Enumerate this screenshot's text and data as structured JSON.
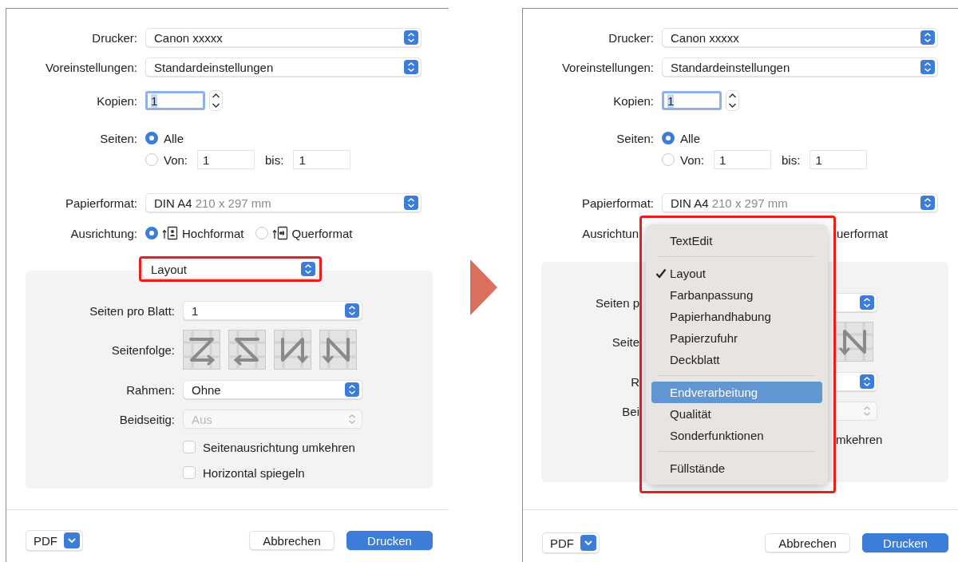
{
  "dialogs": [
    {
      "kind": "full",
      "printer": {
        "label": "Drucker:",
        "value": "Canon xxxxx"
      },
      "presets": {
        "label": "Voreinstellungen:",
        "value": "Standardeinstellungen"
      },
      "copies": {
        "label": "Kopien:",
        "value": "1"
      },
      "pages": {
        "label": "Seiten:",
        "all": {
          "label": "Alle",
          "selected": true
        },
        "range": {
          "label": "Von:",
          "selected": false,
          "from": "1",
          "to_label": "bis:",
          "to": "1"
        }
      },
      "paper": {
        "label": "Papierformat:",
        "value": "DIN A4",
        "size": "210 x 297 mm"
      },
      "orientation": {
        "label": "Ausrichtung:",
        "options": [
          {
            "kind": "portrait",
            "label": "Hochformat",
            "selected": true
          },
          {
            "kind": "landscape",
            "label": "Querformat",
            "selected": false
          }
        ]
      },
      "section": {
        "value": "Layout",
        "highlighted": true
      },
      "layout": {
        "pages_per_sheet": {
          "label": "Seiten pro Blatt:",
          "value": "1"
        },
        "order": {
          "label": "Seitenfolge:",
          "options": [
            {
              "kind": "z"
            },
            {
              "kind": "z-reverse"
            },
            {
              "kind": "n-reverse"
            },
            {
              "kind": "n"
            }
          ]
        },
        "border": {
          "label": "Rahmen:",
          "value": "Ohne"
        },
        "two_sided": {
          "label": "Beidseitig:",
          "value": "Aus",
          "disabled": true
        },
        "checkboxes": [
          {
            "label": "Seitenausrichtung umkehren",
            "checked": false
          },
          {
            "label": "Horizontal spiegeln",
            "checked": false
          }
        ]
      },
      "footer": {
        "pdf": "PDF",
        "cancel": "Abbrechen",
        "print": "Drucken"
      }
    },
    {
      "kind": "covered",
      "printer": {
        "label": "Drucker:",
        "value": "Canon xxxxx"
      },
      "presets": {
        "label": "Voreinstellungen:",
        "value": "Standardeinstellungen"
      },
      "copies": {
        "label": "Kopien:",
        "value": "1"
      },
      "pages": {
        "label": "Seiten:",
        "all": {
          "label": "Alle",
          "selected": true
        },
        "range": {
          "label": "Von:",
          "selected": false,
          "from": "1",
          "to_label": "bis:",
          "to": "1"
        }
      },
      "paper": {
        "label": "Papierformat:",
        "value": "DIN A4",
        "size": "210 x 297 mm"
      },
      "orientation": {
        "label": "Ausrichtun",
        "remnant": "uerformat"
      },
      "layout": {
        "pages_per_sheet": {
          "label": "Seiten p"
        },
        "order": {
          "label": "Seite",
          "options": [
            {
              "kind": "n"
            }
          ]
        },
        "border": {
          "label": "R"
        },
        "two_sided": {
          "label": "Bei",
          "disabled": true
        },
        "checkbox_remnant": "mkehren"
      },
      "menu": {
        "highlighted": true,
        "items": [
          {
            "kind": "item",
            "label": "TextEdit",
            "checked": false,
            "highlighted": false
          },
          {
            "kind": "separator"
          },
          {
            "kind": "item",
            "label": "Layout",
            "checked": true,
            "highlighted": false
          },
          {
            "kind": "item",
            "label": "Farbanpassung",
            "checked": false,
            "highlighted": false
          },
          {
            "kind": "item",
            "label": "Papierhandhabung",
            "checked": false,
            "highlighted": false
          },
          {
            "kind": "item",
            "label": "Papierzufuhr",
            "checked": false,
            "highlighted": false
          },
          {
            "kind": "item",
            "label": "Deckblatt",
            "checked": false,
            "highlighted": false
          },
          {
            "kind": "separator"
          },
          {
            "kind": "item",
            "label": "Endverarbeitung",
            "checked": false,
            "highlighted": true
          },
          {
            "kind": "item",
            "label": "Qualität",
            "checked": false,
            "highlighted": false
          },
          {
            "kind": "item",
            "label": "Sonderfunktionen",
            "checked": false,
            "highlighted": false
          },
          {
            "kind": "separator"
          },
          {
            "kind": "item",
            "label": "Füllstände",
            "checked": false,
            "highlighted": false
          }
        ]
      },
      "footer": {
        "pdf": "PDF",
        "cancel": "Abbrechen",
        "print": "Drucken"
      }
    }
  ]
}
